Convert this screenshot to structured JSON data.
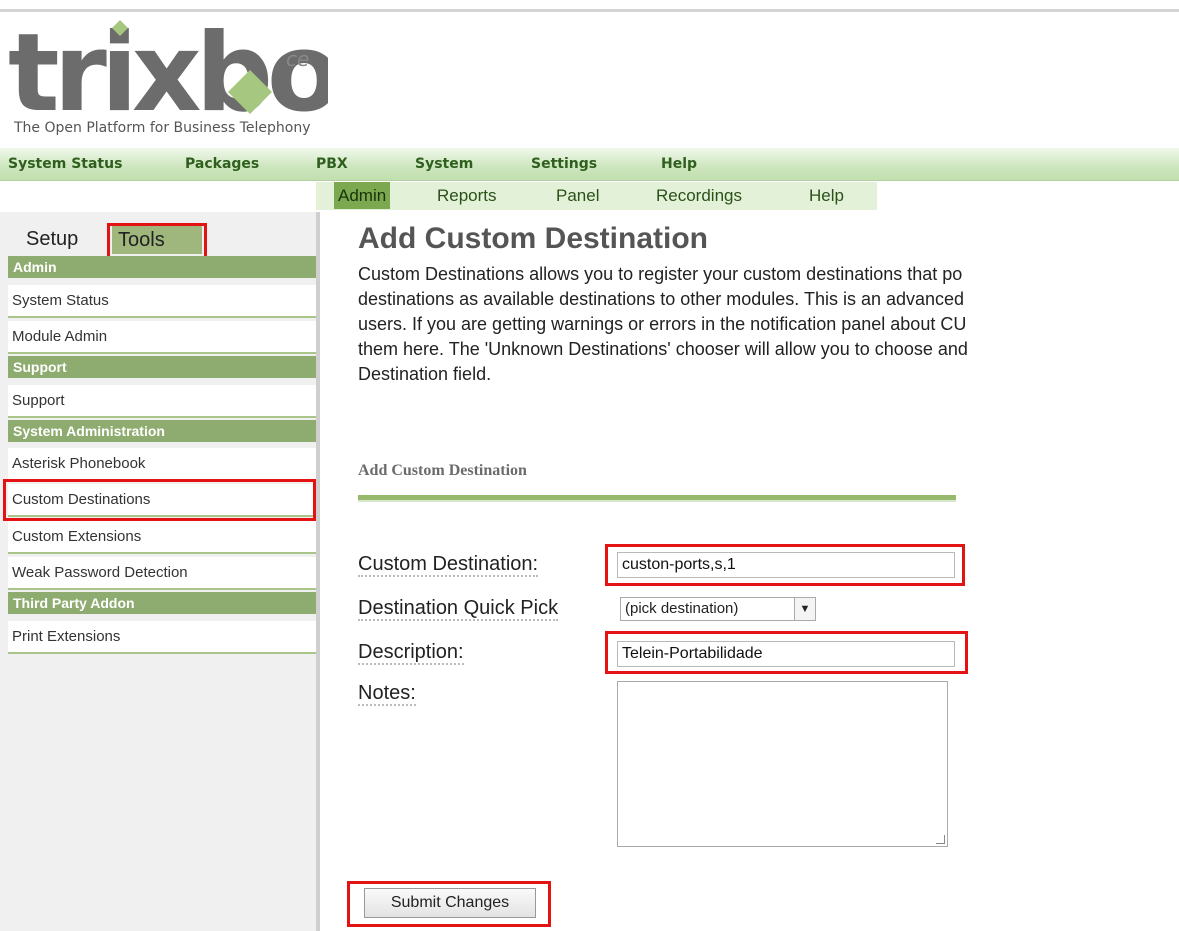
{
  "branding": {
    "logo_text": "trixbox",
    "logo_edition": "ce",
    "tagline": "The Open Platform for Business Telephony"
  },
  "top_menu": [
    "System Status",
    "Packages",
    "PBX",
    "System",
    "Settings",
    "Help"
  ],
  "sub_menu": {
    "items": [
      "Admin",
      "Reports",
      "Panel",
      "Recordings",
      "Help"
    ],
    "active": "Admin"
  },
  "sidebar": {
    "tabs": [
      "Setup",
      "Tools"
    ],
    "active_tab": "Tools",
    "sections": [
      {
        "title": "Admin",
        "items": [
          "System Status",
          "Module Admin"
        ]
      },
      {
        "title": "Support",
        "items": [
          "Support"
        ]
      },
      {
        "title": "System Administration",
        "items": [
          "Asterisk Phonebook",
          "Custom Destinations",
          "Custom Extensions",
          "Weak Password Detection"
        ]
      },
      {
        "title": "Third Party Addon",
        "items": [
          "Print Extensions"
        ]
      }
    ]
  },
  "main": {
    "title": "Add Custom Destination",
    "description_lines": [
      "Custom Destinations allows you to register your custom destinations that po",
      "destinations as available destinations to other modules. This is an advanced",
      "users. If you are getting warnings or errors in the notification panel about CU",
      "them here. The 'Unknown Destinations' chooser will allow you to choose and",
      "Destination field."
    ],
    "form_heading": "Add Custom Destination",
    "fields": {
      "custom_destination": {
        "label": "Custom Destination:",
        "value": "custon-ports,s,1"
      },
      "quick_pick": {
        "label": "Destination Quick Pick",
        "value": "(pick destination)"
      },
      "description": {
        "label": "Description:",
        "value": "Telein-Portabilidade"
      },
      "notes": {
        "label": "Notes:",
        "value": ""
      }
    },
    "submit_label": "Submit Changes"
  },
  "colors": {
    "accent_green": "#8fac70",
    "highlight_red": "#e31313",
    "menu_text": "#2f5f1e"
  }
}
